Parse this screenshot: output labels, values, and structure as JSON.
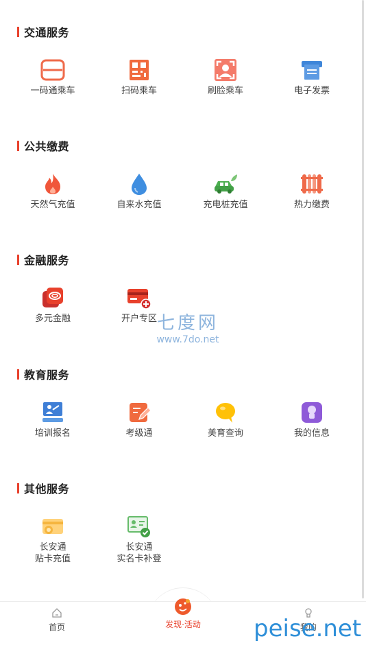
{
  "sections": [
    {
      "title": "交通服务",
      "items": [
        {
          "label": "一码通乘车",
          "icon": "card-reader-icon"
        },
        {
          "label": "扫码乘车",
          "icon": "qr-code-icon"
        },
        {
          "label": "刷脸乘车",
          "icon": "face-scan-icon"
        },
        {
          "label": "电子发票",
          "icon": "invoice-printer-icon"
        }
      ]
    },
    {
      "title": "公共缴费",
      "items": [
        {
          "label": "天然气充值",
          "icon": "flame-icon"
        },
        {
          "label": "自来水充值",
          "icon": "water-drop-icon"
        },
        {
          "label": "充电桩充值",
          "icon": "electric-car-icon"
        },
        {
          "label": "热力缴费",
          "icon": "radiator-icon"
        }
      ]
    },
    {
      "title": "金融服务",
      "items": [
        {
          "label": "多元金融",
          "icon": "finance-cards-icon"
        },
        {
          "label": "开户专区",
          "icon": "bank-card-add-icon"
        }
      ]
    },
    {
      "title": "教育服务",
      "items": [
        {
          "label": "培训报名",
          "icon": "training-board-icon"
        },
        {
          "label": "考级通",
          "icon": "exam-edit-icon"
        },
        {
          "label": "美育查询",
          "icon": "chat-bubble-icon"
        },
        {
          "label": "我的信息",
          "icon": "profile-icon"
        }
      ]
    },
    {
      "title": "其他服务",
      "items": [
        {
          "label": "长安通\n贴卡充值",
          "icon": "card-topup-icon"
        },
        {
          "label": "长安通\n实名卡补登",
          "icon": "id-card-verify-icon"
        }
      ]
    }
  ],
  "tabbar": {
    "home": "首页",
    "discover": "发现·活动",
    "mine": "我的"
  },
  "watermark": {
    "site_cn": "七度网",
    "site_url": "www.7do.net",
    "corner_mark": "peise.net"
  },
  "colors": {
    "accent": "#e8412c",
    "blue": "#3f7fd6",
    "green": "#4caf50"
  }
}
